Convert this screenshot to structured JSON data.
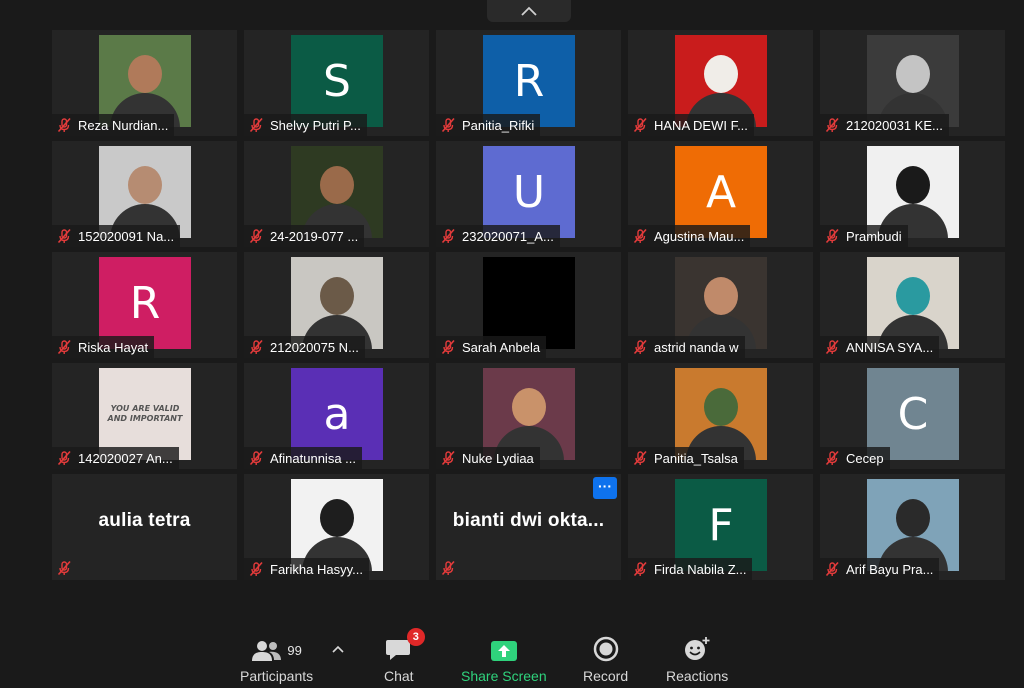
{
  "participants": [
    {
      "name": "Reza Nurdian...",
      "avatar": "photo",
      "bg": "#5b7a48",
      "skin": "#b07a5a"
    },
    {
      "name": "Shelvy Putri P...",
      "avatar": "letter",
      "letter": "S",
      "bg": "#0b5b45"
    },
    {
      "name": "Panitia_Rifki",
      "avatar": "letter",
      "letter": "R",
      "bg": "#0e5fa8"
    },
    {
      "name": "HANA DEWI F...",
      "avatar": "photo",
      "bg": "#c91c1c",
      "skin": "#f0ede8"
    },
    {
      "name": "212020031 KE...",
      "avatar": "photo",
      "bg": "#3b3b3b",
      "skin": "#c4c4c4"
    },
    {
      "name": "152020091 Na...",
      "avatar": "photo",
      "bg": "#c9c9c9",
      "skin": "#b68c72"
    },
    {
      "name": "24-2019-077 ...",
      "avatar": "photo",
      "bg": "#2e3a22",
      "skin": "#9a6a4a"
    },
    {
      "name": "232020071_A...",
      "avatar": "letter",
      "letter": "U",
      "bg": "#5e6bd1"
    },
    {
      "name": "Agustina Mau...",
      "avatar": "letter",
      "letter": "A",
      "bg": "#ef6c05"
    },
    {
      "name": "Prambudi",
      "avatar": "photo",
      "bg": "#f0f0f0",
      "skin": "#1a1a1a"
    },
    {
      "name": "Riska Hayat",
      "avatar": "letter",
      "letter": "R",
      "bg": "#cf1e63"
    },
    {
      "name": "212020075 N...",
      "avatar": "photo",
      "bg": "#c9c7c2",
      "skin": "#6b5a48"
    },
    {
      "name": "Sarah Anbela",
      "avatar": "photo",
      "bg": "#000000",
      "skin": "#000000"
    },
    {
      "name": "astrid nanda w",
      "avatar": "photo",
      "bg": "#3a3430",
      "skin": "#c08a6a"
    },
    {
      "name": "ANNISA SYA...",
      "avatar": "photo",
      "bg": "#d9d4cb",
      "skin": "#2a9aa0"
    },
    {
      "name": "142020027 An...",
      "avatar": "photo",
      "bg": "#e7dedb",
      "skin": "#e7dedb",
      "caption": "YOU ARE VALID AND IMPORTANT"
    },
    {
      "name": "Afinatunnisa ...",
      "avatar": "letter",
      "letter": "a",
      "bg": "#5a2fb5"
    },
    {
      "name": "Nuke Lydiaa",
      "avatar": "photo",
      "bg": "#6b3a4a",
      "skin": "#c9926a"
    },
    {
      "name": "Panitia_Tsalsa",
      "avatar": "photo",
      "bg": "#c97a2e",
      "skin": "#4a6a3a"
    },
    {
      "name": "Cecep",
      "avatar": "letter",
      "letter": "C",
      "bg": "#708591"
    },
    {
      "name": "aulia tetra",
      "avatar": "none"
    },
    {
      "name": "Farikha Hasyy...",
      "avatar": "photo",
      "bg": "#f2f2f2",
      "skin": "#1e1e1e"
    },
    {
      "name": "bianti  dwi  okta...",
      "avatar": "none",
      "more": "···"
    },
    {
      "name": "Firda Nabila Z...",
      "avatar": "letter",
      "letter": "F",
      "bg": "#0b5b45"
    },
    {
      "name": "Arif Bayu Pra...",
      "avatar": "photo",
      "bg": "#7fa3b8",
      "skin": "#2a2a2a"
    }
  ],
  "toolbar": {
    "participants_label": "Participants",
    "participants_count": "99",
    "chat_label": "Chat",
    "chat_badge": "3",
    "share_label": "Share Screen",
    "record_label": "Record",
    "reactions_label": "Reactions"
  },
  "colors": {
    "share_green": "#2fd27c",
    "mic_muted_red": "#e33b3b"
  }
}
